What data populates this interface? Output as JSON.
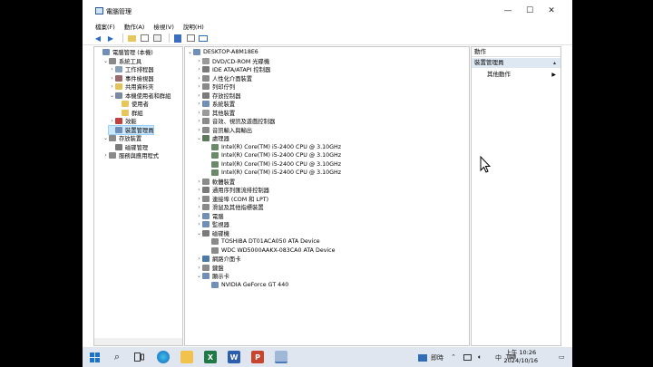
{
  "window": {
    "title": "電腦管理",
    "controls": {
      "minimize": "—",
      "maximize": "☐",
      "close": "✕"
    }
  },
  "menu": [
    "檔案(F)",
    "動作(A)",
    "檢視(V)",
    "說明(H)"
  ],
  "left_tree": [
    {
      "label": "電腦管理 (本機)",
      "level": 0,
      "exp": "",
      "icon": "computer-management-icon",
      "color": "#6f8fb8"
    },
    {
      "label": "系統工具",
      "level": 1,
      "exp": "⌄",
      "icon": "tools-icon",
      "color": "#8a8a8a"
    },
    {
      "label": "工作排程器",
      "level": 2,
      "exp": "›",
      "icon": "clock-icon",
      "color": "#8aa0b8"
    },
    {
      "label": "事件檢視器",
      "level": 2,
      "exp": "›",
      "icon": "event-viewer-icon",
      "color": "#9a6a6a"
    },
    {
      "label": "共用資料夾",
      "level": 2,
      "exp": "›",
      "icon": "shared-folder-icon",
      "color": "#e5c15a"
    },
    {
      "label": "本機使用者和群組",
      "level": 2,
      "exp": "⌄",
      "icon": "users-icon",
      "color": "#7a8aa0"
    },
    {
      "label": "使用者",
      "level": 3,
      "exp": "",
      "icon": "folder-icon",
      "color": "#e8c65e"
    },
    {
      "label": "群組",
      "level": 3,
      "exp": "",
      "icon": "folder-icon",
      "color": "#e8c65e"
    },
    {
      "label": "效能",
      "level": 2,
      "exp": "›",
      "icon": "performance-icon",
      "color": "#c04040"
    },
    {
      "label": "裝置管理員",
      "level": 2,
      "exp": "",
      "icon": "device-manager-icon",
      "color": "#6f8fb8",
      "selected": true
    },
    {
      "label": "存放裝置",
      "level": 1,
      "exp": "⌄",
      "icon": "storage-icon",
      "color": "#8a8a8a"
    },
    {
      "label": "磁碟管理",
      "level": 2,
      "exp": "",
      "icon": "disk-management-icon",
      "color": "#7a7a7a"
    },
    {
      "label": "服務與應用程式",
      "level": 1,
      "exp": "›",
      "icon": "services-icon",
      "color": "#8a8a8a"
    }
  ],
  "device_tree": [
    {
      "label": "DESKTOP-A8M18E6",
      "level": 0,
      "exp": "⌄",
      "icon": "computer-icon",
      "color": "#6f8fb8"
    },
    {
      "label": "DVD/CD-ROM 光碟機",
      "level": 1,
      "exp": "›",
      "icon": "dvd-icon",
      "color": "#9a9a9a"
    },
    {
      "label": "IDE ATA/ATAPI 控制器",
      "level": 1,
      "exp": "›",
      "icon": "ide-controller-icon",
      "color": "#7a7a7a"
    },
    {
      "label": "人性化介面裝置",
      "level": 1,
      "exp": "›",
      "icon": "hid-icon",
      "color": "#8a8a8a"
    },
    {
      "label": "列印佇列",
      "level": 1,
      "exp": "›",
      "icon": "printer-icon",
      "color": "#8a8a8a"
    },
    {
      "label": "存放控制器",
      "level": 1,
      "exp": "›",
      "icon": "storage-controller-icon",
      "color": "#7a7a7a"
    },
    {
      "label": "系統裝置",
      "level": 1,
      "exp": "›",
      "icon": "system-device-icon",
      "color": "#6f8fb8"
    },
    {
      "label": "其他裝置",
      "level": 1,
      "exp": "›",
      "icon": "other-device-icon",
      "color": "#9a9a9a"
    },
    {
      "label": "音效、視訊及遊戲控制器",
      "level": 1,
      "exp": "›",
      "icon": "sound-icon",
      "color": "#8a8a8a"
    },
    {
      "label": "音訊輸入與輸出",
      "level": 1,
      "exp": "›",
      "icon": "audio-io-icon",
      "color": "#8a8a8a"
    },
    {
      "label": "處理器",
      "level": 1,
      "exp": "⌄",
      "icon": "processor-icon",
      "color": "#5a7a5a"
    },
    {
      "label": "Intel(R) Core(TM) i5-2400 CPU @ 3.10GHz",
      "level": 2,
      "exp": "",
      "icon": "cpu-icon",
      "color": "#6a8a6a"
    },
    {
      "label": "Intel(R) Core(TM) i5-2400 CPU @ 3.10GHz",
      "level": 2,
      "exp": "",
      "icon": "cpu-icon",
      "color": "#6a8a6a"
    },
    {
      "label": "Intel(R) Core(TM) i5-2400 CPU @ 3.10GHz",
      "level": 2,
      "exp": "",
      "icon": "cpu-icon",
      "color": "#6a8a6a"
    },
    {
      "label": "Intel(R) Core(TM) i5-2400 CPU @ 3.10GHz",
      "level": 2,
      "exp": "",
      "icon": "cpu-icon",
      "color": "#6a8a6a"
    },
    {
      "label": "軟體裝置",
      "level": 1,
      "exp": "›",
      "icon": "software-device-icon",
      "color": "#8a8a8a"
    },
    {
      "label": "通用序列匯流排控制器",
      "level": 1,
      "exp": "›",
      "icon": "usb-icon",
      "color": "#7a7a7a"
    },
    {
      "label": "連接埠 (COM 和 LPT)",
      "level": 1,
      "exp": "›",
      "icon": "port-icon",
      "color": "#8a8a8a"
    },
    {
      "label": "滑鼠及其他指標裝置",
      "level": 1,
      "exp": "›",
      "icon": "mouse-icon",
      "color": "#8a8a8a"
    },
    {
      "label": "電腦",
      "level": 1,
      "exp": "›",
      "icon": "computer-icon",
      "color": "#6f8fb8"
    },
    {
      "label": "監視器",
      "level": 1,
      "exp": "›",
      "icon": "monitor-icon",
      "color": "#6f8fb8"
    },
    {
      "label": "磁碟機",
      "level": 1,
      "exp": "⌄",
      "icon": "disk-drive-icon",
      "color": "#7a7a7a"
    },
    {
      "label": "TOSHIBA DT01ACA050 ATA Device",
      "level": 2,
      "exp": "",
      "icon": "hard-disk-icon",
      "color": "#8a8a8a"
    },
    {
      "label": "WDC WD5000AAKX-083CA0 ATA Device",
      "level": 2,
      "exp": "",
      "icon": "hard-disk-icon",
      "color": "#8a8a8a"
    },
    {
      "label": "網路介面卡",
      "level": 1,
      "exp": "›",
      "icon": "network-adapter-icon",
      "color": "#4a7aa8"
    },
    {
      "label": "鍵盤",
      "level": 1,
      "exp": "›",
      "icon": "keyboard-icon",
      "color": "#8a8a8a"
    },
    {
      "label": "顯示卡",
      "level": 1,
      "exp": "⌄",
      "icon": "display-adapter-icon",
      "color": "#6f8fb8"
    },
    {
      "label": "NVIDIA GeForce GT 440",
      "level": 2,
      "exp": "",
      "icon": "gpu-icon",
      "color": "#6f8fb8"
    }
  ],
  "actions": {
    "header": "動作",
    "section": "裝置管理員",
    "item": "其他動作",
    "arrow": "▶"
  },
  "taskbar": {
    "weather_text": "即時",
    "ime": "中",
    "time": "上午 10:26",
    "date": "2024/10/16"
  }
}
